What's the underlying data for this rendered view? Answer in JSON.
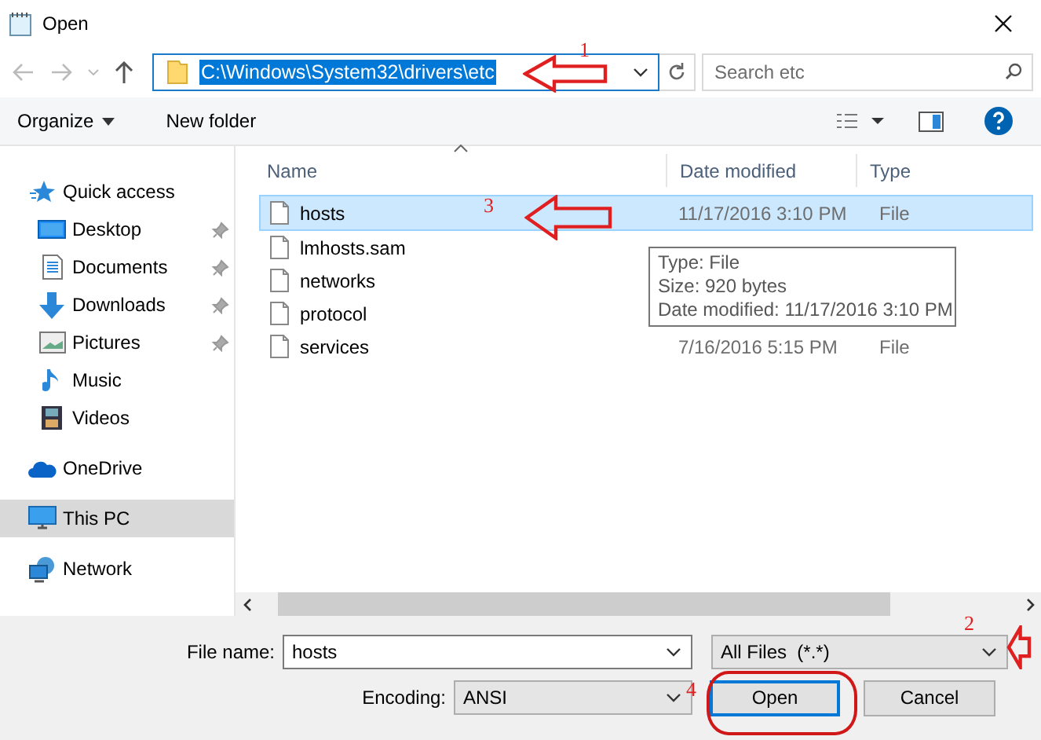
{
  "window": {
    "title": "Open"
  },
  "address": {
    "path": "C:\\Windows\\System32\\drivers\\etc",
    "selected": true
  },
  "search": {
    "placeholder": "Search etc"
  },
  "toolbar": [
    {
      "label": "Organize",
      "kind": "menu"
    },
    {
      "label": "New folder",
      "kind": "button"
    }
  ],
  "sidebar": {
    "items": [
      {
        "label": "Quick access",
        "kind": "group",
        "pinned": false,
        "selected": false
      },
      {
        "label": "Desktop",
        "kind": "child",
        "pinned": true,
        "selected": false
      },
      {
        "label": "Documents",
        "kind": "child",
        "pinned": true,
        "selected": false
      },
      {
        "label": "Downloads",
        "kind": "child",
        "pinned": true,
        "selected": false
      },
      {
        "label": "Pictures",
        "kind": "child",
        "pinned": true,
        "selected": false
      },
      {
        "label": "Music",
        "kind": "child",
        "pinned": false,
        "selected": false
      },
      {
        "label": "Videos",
        "kind": "child",
        "pinned": false,
        "selected": false
      },
      {
        "label": "OneDrive",
        "kind": "group",
        "pinned": false,
        "selected": false
      },
      {
        "label": "This PC",
        "kind": "group",
        "pinned": false,
        "selected": true
      },
      {
        "label": "Network",
        "kind": "group",
        "pinned": false,
        "selected": false
      }
    ]
  },
  "columns": [
    {
      "label": "Name",
      "sorted": true
    },
    {
      "label": "Date modified",
      "sorted": false
    },
    {
      "label": "Type",
      "sorted": false
    }
  ],
  "files": [
    {
      "name": "hosts",
      "date": "11/17/2016 3:10 PM",
      "type": "File",
      "selected": true
    },
    {
      "name": "lmhosts.sam",
      "selected": false
    },
    {
      "name": "networks",
      "selected": false
    },
    {
      "name": "protocol",
      "selected": false
    },
    {
      "name": "services",
      "date": "7/16/2016 5:15 PM",
      "type": "File",
      "selected": false
    }
  ],
  "tooltip": {
    "lines": [
      "Type: File",
      "Size: 920 bytes",
      "Date modified: 11/17/2016 3:10 PM"
    ]
  },
  "bottom": {
    "file_name_label": "File name:",
    "file_name": "hosts",
    "filter": "All Files  (*.*)",
    "encoding_label": "Encoding:",
    "encoding": "ANSI",
    "buttons": [
      {
        "label": "Open",
        "default": true
      },
      {
        "label": "Cancel",
        "default": false
      }
    ]
  },
  "annotations": [
    {
      "number": "1",
      "kind": "arrow"
    },
    {
      "number": "2",
      "kind": "arrow"
    },
    {
      "number": "3",
      "kind": "arrow"
    },
    {
      "number": "4",
      "kind": "ellipse"
    }
  ]
}
